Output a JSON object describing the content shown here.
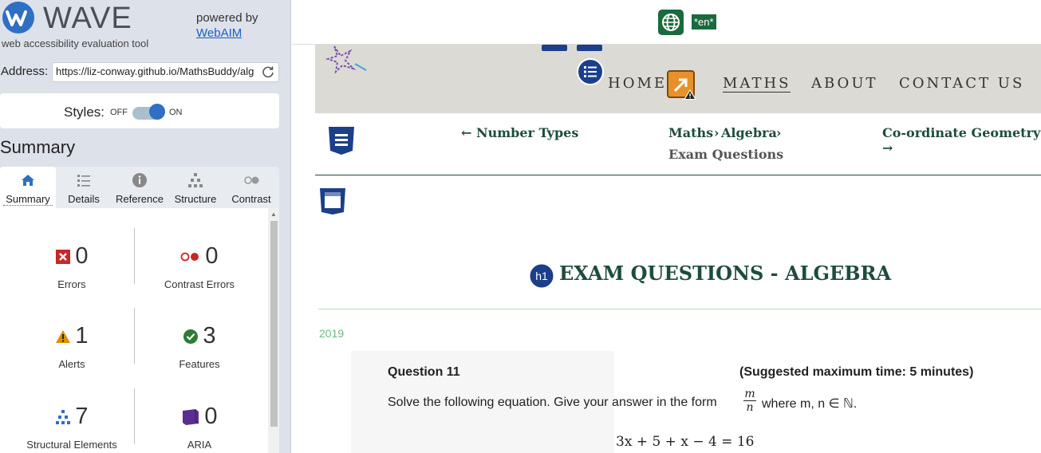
{
  "wave": {
    "logo_text": "WAVE",
    "tagline": "web accessibility evaluation tool",
    "powered_by": "powered by",
    "webaim_link": "WebAIM",
    "address_label": "Address:",
    "address_value": "https://liz-conway.github.io/MathsBuddy/alg",
    "styles_label": "Styles:",
    "styles_off": "OFF",
    "styles_on": "ON",
    "styles_enabled": true,
    "summary_title": "Summary",
    "tabs": [
      {
        "label": "Summary",
        "icon": "home-icon",
        "active": true
      },
      {
        "label": "Details",
        "icon": "list-icon",
        "active": false
      },
      {
        "label": "Reference",
        "icon": "info-icon",
        "active": false
      },
      {
        "label": "Structure",
        "icon": "structure-icon",
        "active": false
      },
      {
        "label": "Contrast",
        "icon": "contrast-icon",
        "active": false
      }
    ],
    "stats": [
      {
        "label": "Errors",
        "count": "0",
        "icon": "error-icon",
        "color": "#c62828"
      },
      {
        "label": "Contrast Errors",
        "count": "0",
        "icon": "contrast-error-icon",
        "color": "#c62828"
      },
      {
        "label": "Alerts",
        "count": "1",
        "icon": "alert-icon",
        "color": "#e38b00"
      },
      {
        "label": "Features",
        "count": "3",
        "icon": "feature-icon",
        "color": "#2e7d32"
      },
      {
        "label": "Structural Elements",
        "count": "7",
        "icon": "structure-icon",
        "color": "#2f6fc4"
      },
      {
        "label": "ARIA",
        "count": "0",
        "icon": "aria-icon",
        "color": "#5b2d8e"
      }
    ]
  },
  "page": {
    "lang_badge": "*en*",
    "nav": {
      "home": "HOME",
      "maths": "MATHS",
      "about": "ABOUT",
      "contact": "CONTACT US"
    },
    "breadcrumb": {
      "prev": "← Number Types",
      "path1": "Maths",
      "sep1": "›",
      "path2": "Algebra",
      "sep2": "›",
      "current": "Exam Questions",
      "next": "Co-ordinate Geometry →"
    },
    "h1_badge": "h1",
    "title": "EXAM QUESTIONS - ALGEBRA",
    "year": "2019",
    "question": {
      "title": "Question 11",
      "time": "(Suggested maximum time: 5 minutes)",
      "text": "Solve the following equation.  Give your answer in the form",
      "frac_num": "m",
      "frac_den": "n",
      "where": "where m, n ∈ ℕ.",
      "equation": "3x + 5   +   x − 4   = 16"
    },
    "colors": {
      "brand_green": "#1e4d3a",
      "nav_band": "#dcdad4",
      "wave_blue": "#2f6fc4"
    }
  }
}
